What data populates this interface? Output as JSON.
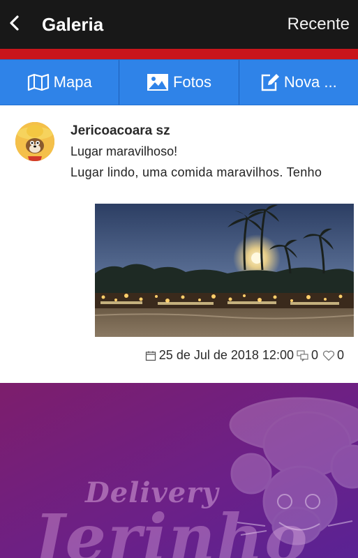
{
  "appbar": {
    "title": "Galeria",
    "action_label": "Recente"
  },
  "tabs": [
    {
      "label": "Mapa",
      "icon": "map-icon"
    },
    {
      "label": "Fotos",
      "icon": "image-icon"
    },
    {
      "label": "Nova ...",
      "icon": "edit-icon"
    }
  ],
  "post": {
    "author": "Jericoacoara sz",
    "title": "Lugar maravilhoso!",
    "body": "Lugar lindo, uma comida maravilhos. Tenho",
    "date": "25 de Jul de 2018 12:00",
    "comments": "0",
    "likes": "0"
  },
  "banner": {
    "line1": "Delivery",
    "line2": "Jerinho"
  },
  "colors": {
    "appbar": "#181818",
    "accent_red": "#c9151b",
    "tab_blue": "#2f83e8",
    "banner_purple": "#6a2185"
  }
}
